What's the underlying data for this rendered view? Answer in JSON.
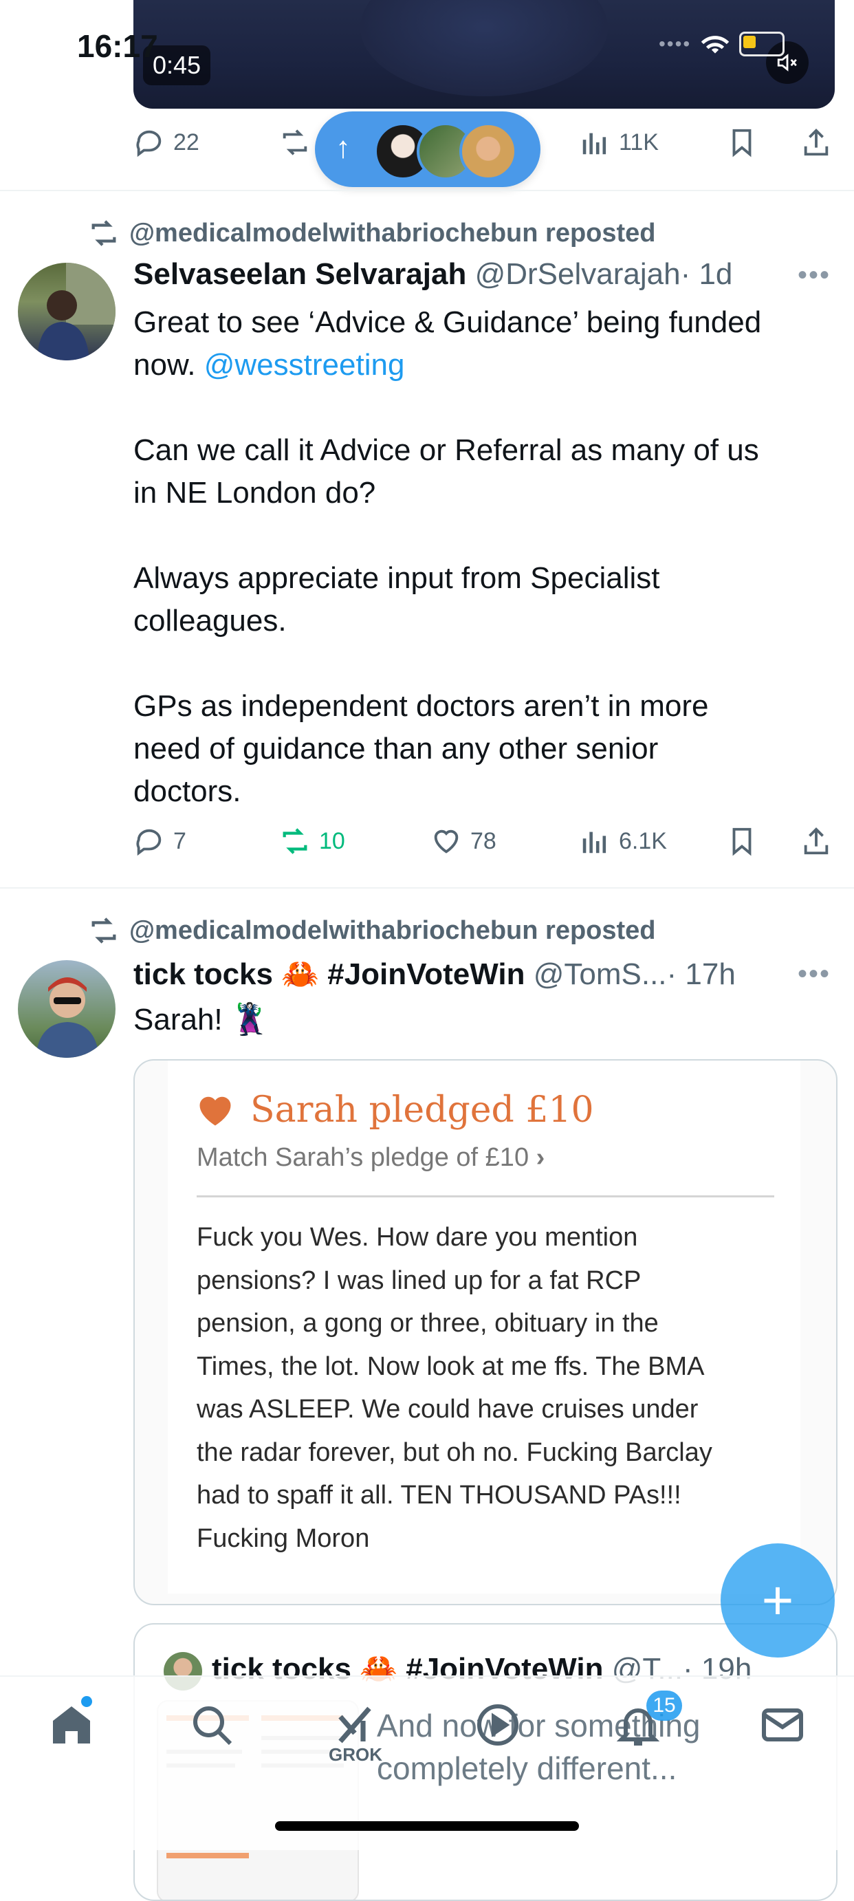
{
  "status_bar": {
    "time": "16:17"
  },
  "video": {
    "timer": "0:45"
  },
  "top_actions": {
    "replies": "22",
    "views": "11K"
  },
  "tweets": [
    {
      "repost_label": "@medicalmodelwithabriochebun reposted",
      "name": "Selvaseelan Selvarajah",
      "handle": "@DrSelvarajah",
      "time": "· 1d",
      "text_line1": "Great to see ‘Advice & Guidance’ being funded",
      "text_line2_prefix": "now. ",
      "mention": "@wesstreeting",
      "text_rest": "Can we call it Advice or Referral as many of us\nin NE London do?\n\nAlways appreciate input from Specialist\ncolleagues.\n\nGPs as independent doctors aren’t in more\nneed of guidance than any other senior\ndoctors.",
      "replies": "7",
      "reposts": "10",
      "likes": "78",
      "views": "6.1K"
    },
    {
      "repost_label": "@medicalmodelwithabriochebun reposted",
      "name": "tick tocks 🦀 #JoinVoteWin",
      "handle": "@TomS...",
      "time": "· 17h",
      "text": "Sarah! 🦹‍♀️",
      "card": {
        "title": "Sarah pledged £10",
        "subtitle": "Match Sarah’s pledge of £10",
        "body": "Fuck you Wes. How dare you mention\npensions? I was lined up for a fat RCP\npension, a gong or three, obituary in the\nTimes, the lot. Now look at me ffs. The BMA\nwas ASLEEP. We could have cruises under\nthe radar forever, but oh no. Fucking Barclay\nhad to spaff it all. TEN THOUSAND PAs!!!\nFucking Moron"
      }
    }
  ],
  "quoted": {
    "name": "tick tocks 🦀 #JoinVoteWin",
    "handle": "@T...",
    "time": "· 19h",
    "text": "And now for something\ncompletely different..."
  },
  "nav": {
    "grok_label": "GROK",
    "notifications_badge": "15"
  },
  "colors": {
    "accent": "#1d9bf0",
    "repost_green": "#00ba7c",
    "pledge_orange": "#e0733b"
  }
}
